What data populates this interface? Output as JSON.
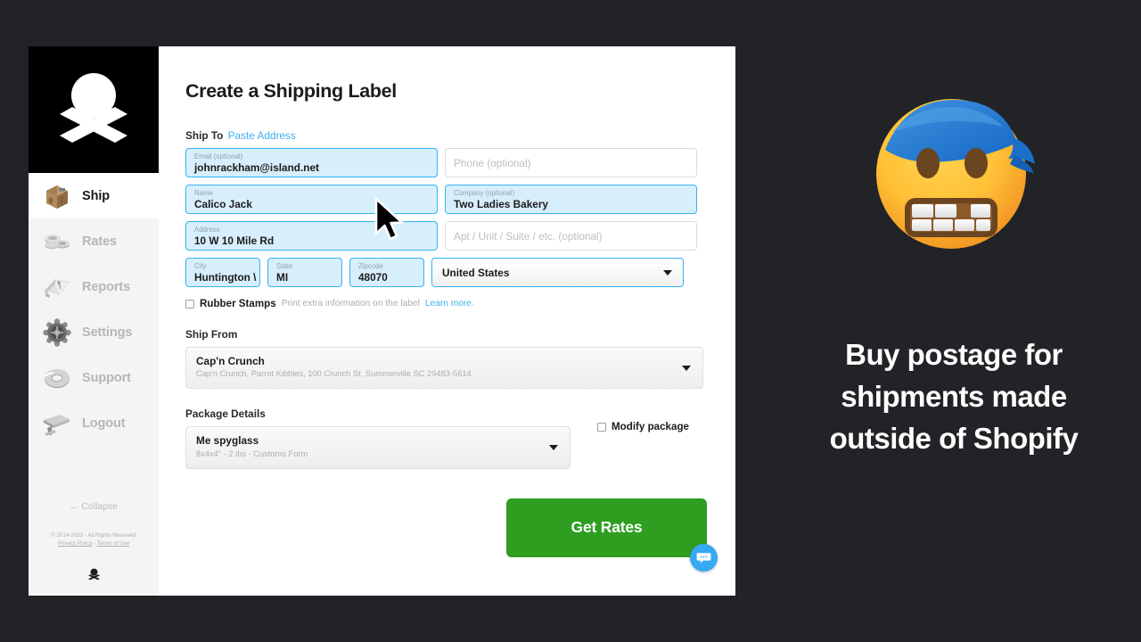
{
  "colors": {
    "page_background": "#212327",
    "sidebar_background": "#f4f4f4",
    "logo_background": "#000000",
    "accent_blue": "#3dafec",
    "field_filled_fill": "#d7eefc",
    "field_filled_border": "#36b3f2",
    "button_green": "#2f9e20",
    "chat_blue": "#36a9f0"
  },
  "sidebar": {
    "logo_icon": "skull-and-crossbones-icon",
    "items": [
      {
        "label": "Ship",
        "icon": "shipping-box-icon",
        "active": true
      },
      {
        "label": "Rates",
        "icon": "coins-stack-icon",
        "active": false
      },
      {
        "label": "Reports",
        "icon": "open-book-icon",
        "active": false
      },
      {
        "label": "Settings",
        "icon": "ship-wheel-icon",
        "active": false
      },
      {
        "label": "Support",
        "icon": "life-ring-icon",
        "active": false
      },
      {
        "label": "Logout",
        "icon": "gangplank-icon",
        "active": false
      }
    ],
    "collapse_label": "Collapse",
    "collapse_icon": "arrow-left-icon",
    "copyright": "© 2014-2023 - All Rights Reserved",
    "privacy_policy": "Privacy Policy",
    "separator": " - ",
    "terms_of_use": "Terms of Use",
    "footer_icon": "skull-and-crossbones-icon"
  },
  "main": {
    "page_title": "Create a Shipping Label",
    "ship_to": {
      "label": "Ship To",
      "paste_address_link": "Paste Address",
      "fields": {
        "email": {
          "label": "Email (optional)",
          "value": "johnrackham@island.net",
          "filled": true
        },
        "phone": {
          "placeholder": "Phone (optional)",
          "filled": false
        },
        "name": {
          "label": "Name",
          "value": "Calico Jack",
          "filled": true
        },
        "company": {
          "label": "Company (optional)",
          "value": "Two Ladies Bakery",
          "filled": true
        },
        "address": {
          "label": "Address",
          "value": "10 W 10 Mile Rd",
          "filled": true
        },
        "apt": {
          "placeholder": "Apt / Unit / Suite / etc. (optional)",
          "filled": false
        },
        "city": {
          "label": "City",
          "value": "Huntington \\",
          "filled": true
        },
        "state": {
          "label": "State",
          "value": "MI",
          "filled": true
        },
        "zipcode": {
          "label": "Zipcode",
          "value": "48070",
          "filled": true
        },
        "country": {
          "value": "United States",
          "options": [
            "United States"
          ]
        }
      }
    },
    "rubber_stamps": {
      "checked": false,
      "title": "Rubber Stamps",
      "description": "Print extra information on the label",
      "learn_more": "Learn more."
    },
    "ship_from": {
      "label": "Ship From",
      "selected_title": "Cap'n Crunch",
      "selected_subtitle": "Cap'n Crunch, Parrot Kibbles, 100 Crunch St, Summerville SC 29483-5614"
    },
    "package_details": {
      "label": "Package Details",
      "selected_title": "Me spyglass",
      "selected_subtitle": "8x4x4\" - 2 lbs - Customs Form",
      "modify_checkbox_label": "Modify package",
      "modify_checked": false
    },
    "get_rates_button": "Get Rates",
    "chat_icon": "chat-bubble-icon"
  },
  "promo": {
    "emoji_icon": "grimacing-face-with-bandana-icon",
    "headline": "Buy postage for shipments made outside of Shopify"
  }
}
